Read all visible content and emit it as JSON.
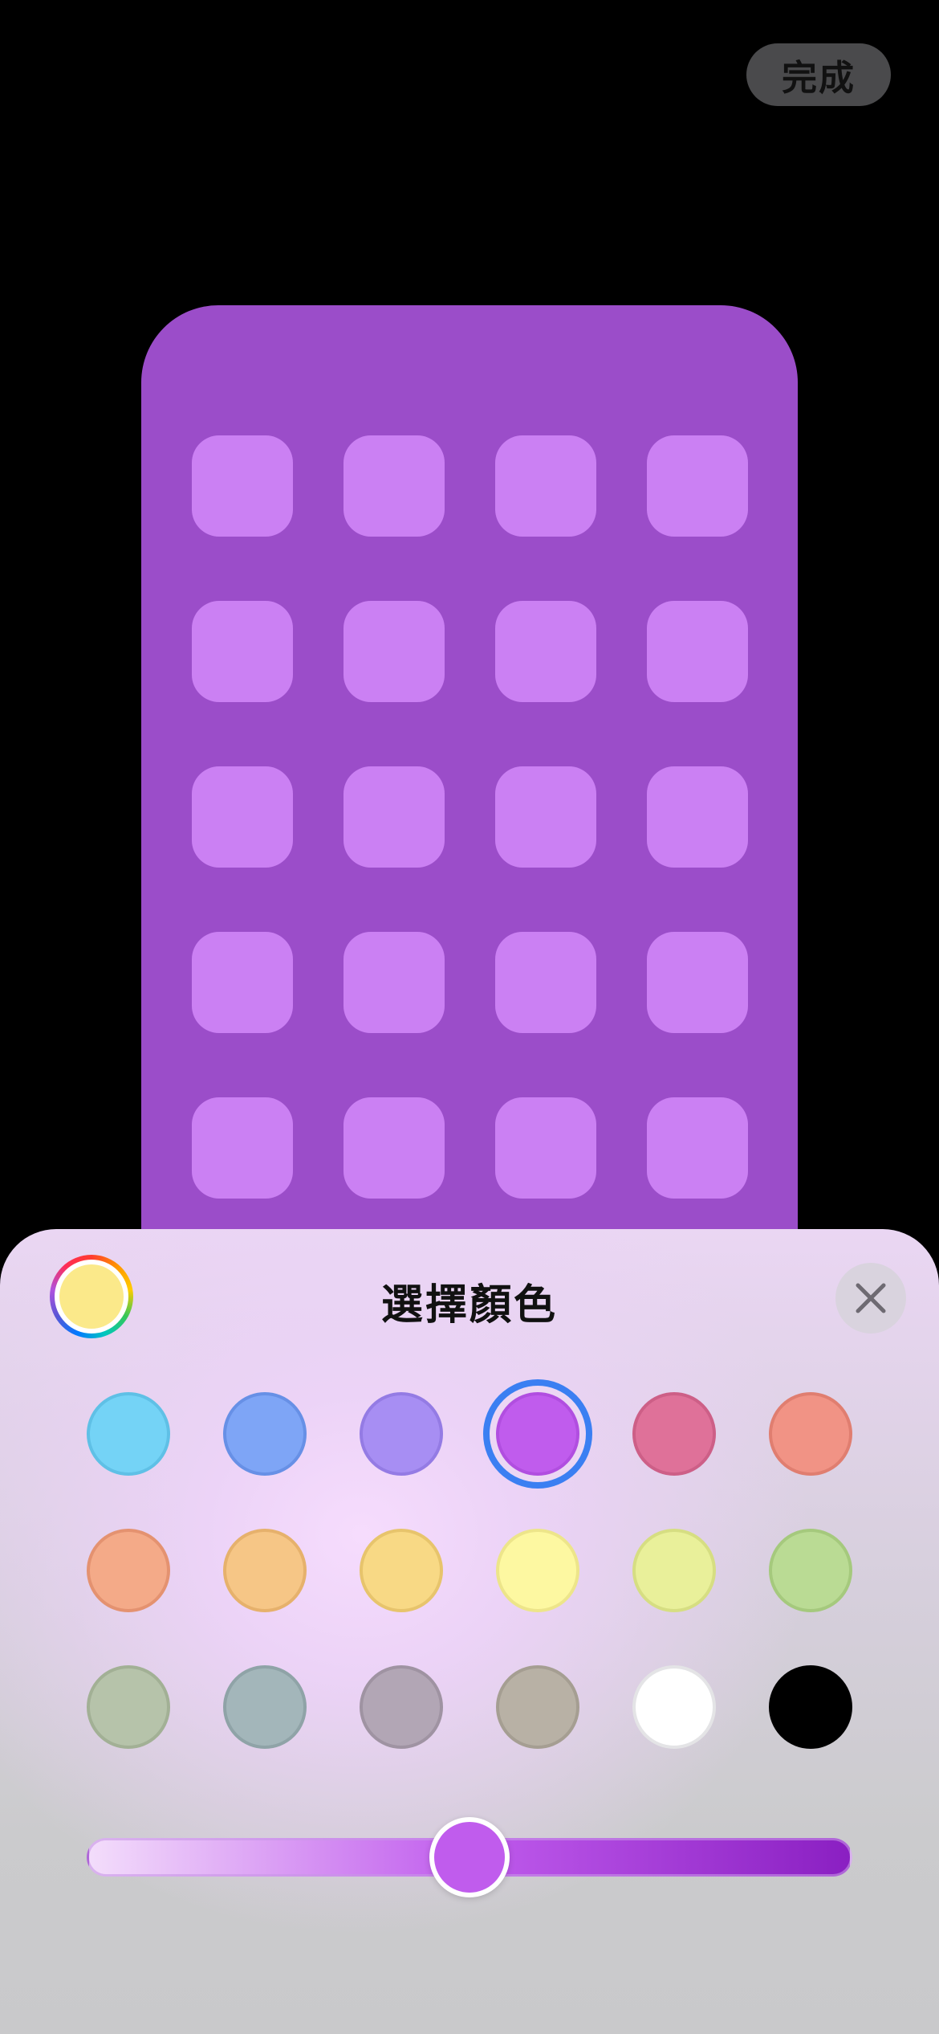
{
  "header": {
    "done_label": "完成"
  },
  "preview": {
    "background_color": "#9b4dc9",
    "icon_color": "#cb80f3",
    "icon_rows": 5,
    "icon_cols": 4
  },
  "sheet": {
    "title": "選擇顏色",
    "picker_color": "#fbe98a",
    "close_icon": "close-icon"
  },
  "swatches": [
    {
      "name": "light-blue",
      "color": "#74d3f6",
      "border": "#5fc0e6",
      "selected": false
    },
    {
      "name": "blue",
      "color": "#7ea5f6",
      "border": "#6790e6",
      "selected": false
    },
    {
      "name": "lavender",
      "color": "#a78ef3",
      "border": "#947be4",
      "selected": false
    },
    {
      "name": "purple",
      "color": "#c05ced",
      "border": "#b14ee0",
      "selected": true
    },
    {
      "name": "pink",
      "color": "#df7199",
      "border": "#cd5f87",
      "selected": false
    },
    {
      "name": "salmon",
      "color": "#f19385",
      "border": "#e07e70",
      "selected": false
    },
    {
      "name": "orange",
      "color": "#f4aa88",
      "border": "#e49270",
      "selected": false
    },
    {
      "name": "light-orange",
      "color": "#f6c686",
      "border": "#e6b16c",
      "selected": false
    },
    {
      "name": "yellow-orange",
      "color": "#f8d985",
      "border": "#e7c46c",
      "selected": false
    },
    {
      "name": "light-yellow",
      "color": "#fdf8a1",
      "border": "#ede58a",
      "selected": false
    },
    {
      "name": "lime",
      "color": "#e9f09a",
      "border": "#d6de82",
      "selected": false
    },
    {
      "name": "green",
      "color": "#badb94",
      "border": "#a5c97d",
      "selected": false
    },
    {
      "name": "sage",
      "color": "#b6c3aa",
      "border": "#a2b095",
      "selected": false
    },
    {
      "name": "slate",
      "color": "#a3b6ba",
      "border": "#8fa3a7",
      "selected": false
    },
    {
      "name": "mauve-gray",
      "color": "#b2a6b5",
      "border": "#9f93a2",
      "selected": false
    },
    {
      "name": "taupe",
      "color": "#b8b1a5",
      "border": "#a59e92",
      "selected": false
    },
    {
      "name": "white",
      "color": "#ffffff",
      "border": "#e4e4e6",
      "selected": false
    },
    {
      "name": "black",
      "color": "#000000",
      "border": "#000000",
      "selected": false
    }
  ],
  "slider": {
    "value": 0.5,
    "thumb_color": "#c05ced",
    "gradient_start": "#f3ddfb",
    "gradient_mid": "#c05ced",
    "gradient_end": "#8a1fc2"
  }
}
